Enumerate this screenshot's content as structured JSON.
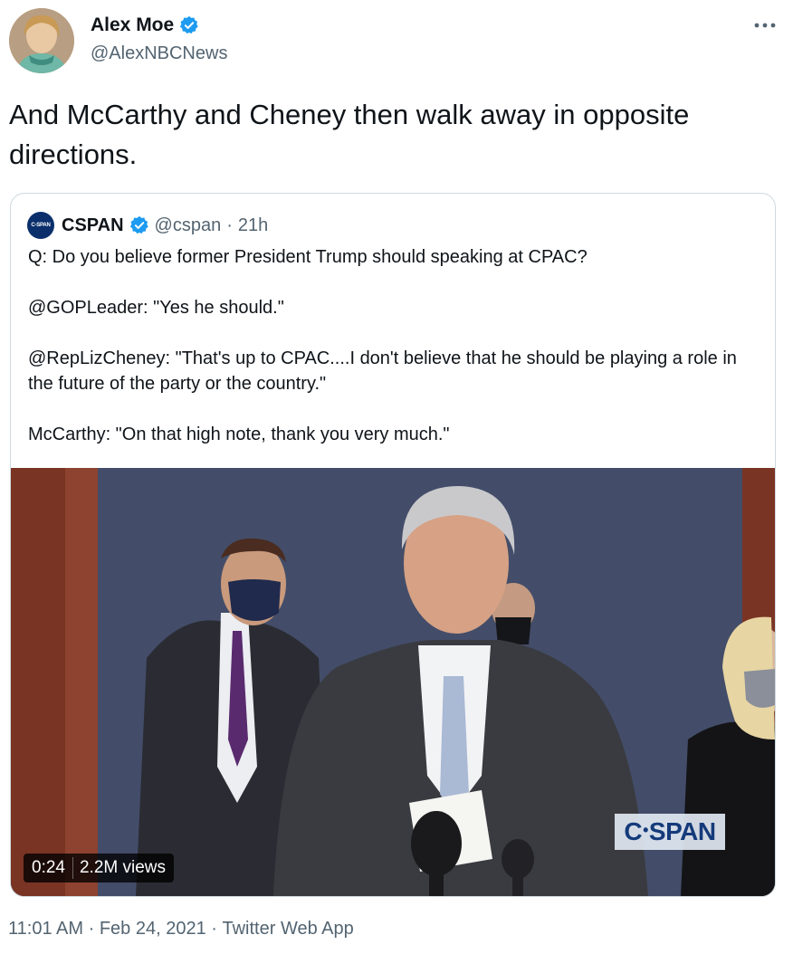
{
  "author": {
    "display_name": "Alex Moe",
    "handle": "@AlexNBCNews",
    "verified_icon": "verified-badge-icon"
  },
  "more_icon": "more-horizontal-icon",
  "tweet": {
    "text": "And McCarthy and Cheney then walk away in opposite directions."
  },
  "quote": {
    "logo_text": "C-SPAN",
    "display_name": "CSPAN",
    "handle": "@cspan",
    "separator": "·",
    "time": "21h",
    "paragraphs": [
      "Q: Do you believe former President Trump should speaking at CPAC?",
      "@GOPLeader: \"Yes he should.\"",
      "@RepLizCheney: \"That's up to CPAC....I don't believe that he should be playing a role in the future of the party or the country.\"",
      "McCarthy: \"On that high note, thank you very much.\""
    ],
    "video": {
      "watermark_c": "C",
      "watermark_dot": "•",
      "watermark_span": "SPAN",
      "duration": "0:24",
      "views": "2.2M views"
    }
  },
  "footer": {
    "time": "11:01 AM",
    "sep1": "·",
    "date": "Feb 24, 2021",
    "sep2": "·",
    "source": "Twitter Web App"
  },
  "colors": {
    "text": "#0f1419",
    "secondary": "#536471",
    "verified": "#1d9bf0",
    "border": "#cfd9de"
  }
}
